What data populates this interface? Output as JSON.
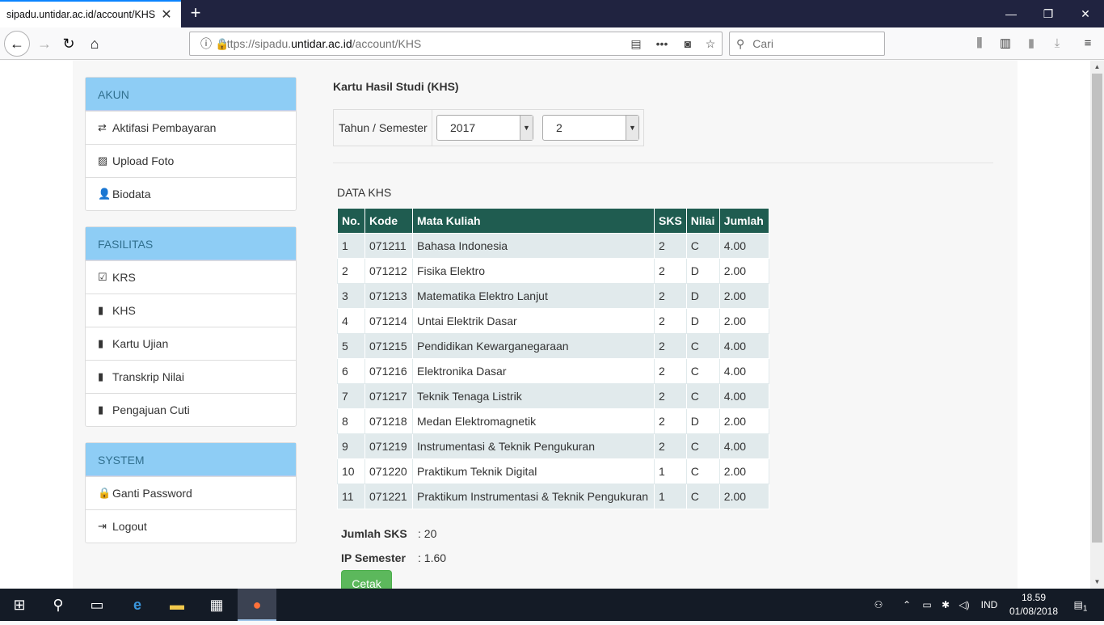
{
  "browser": {
    "tab_title": "sipadu.untidar.ac.id/account/KHS",
    "tab_close": "✕",
    "new_tab": "+",
    "url_prefix": "https://sipadu.",
    "url_domain": "untidar.ac.id",
    "url_path": "/account/KHS",
    "search_placeholder": "Cari",
    "window_controls": [
      "—",
      "❐",
      "✕"
    ]
  },
  "sidebar": {
    "akun": {
      "title": "AKUN",
      "items": [
        {
          "label": "Aktifasi Pembayaran",
          "icon": "transfer-icon"
        },
        {
          "label": "Upload Foto",
          "icon": "picture-icon"
        },
        {
          "label": "Biodata",
          "icon": "user-icon"
        }
      ]
    },
    "fasilitas": {
      "title": "FASILITAS",
      "items": [
        {
          "label": "KRS",
          "icon": "checkbox-icon"
        },
        {
          "label": "KHS",
          "icon": "file-icon"
        },
        {
          "label": "Kartu Ujian",
          "icon": "file-icon"
        },
        {
          "label": "Transkrip Nilai",
          "icon": "file-icon"
        },
        {
          "label": "Pengajuan Cuti",
          "icon": "file-icon"
        }
      ]
    },
    "system": {
      "title": "SYSTEM",
      "items": [
        {
          "label": "Ganti Password",
          "icon": "lock-icon"
        },
        {
          "label": "Logout",
          "icon": "logout-icon"
        }
      ]
    }
  },
  "main": {
    "title": "Kartu Hasil Studi (KHS)",
    "filter_label": "Tahun / Semester",
    "year_value": "2017",
    "semester_value": "2",
    "caption": "DATA KHS",
    "columns": [
      "No.",
      "Kode",
      "Mata Kuliah",
      "SKS",
      "Nilai",
      "Jumlah"
    ],
    "rows": [
      [
        "1",
        "071211",
        "Bahasa Indonesia",
        "2",
        "C",
        "4.00"
      ],
      [
        "2",
        "071212",
        "Fisika Elektro",
        "2",
        "D",
        "2.00"
      ],
      [
        "3",
        "071213",
        "Matematika Elektro Lanjut",
        "2",
        "D",
        "2.00"
      ],
      [
        "4",
        "071214",
        "Untai Elektrik Dasar",
        "2",
        "D",
        "2.00"
      ],
      [
        "5",
        "071215",
        "Pendidikan Kewarganegaraan",
        "2",
        "C",
        "4.00"
      ],
      [
        "6",
        "071216",
        "Elektronika Dasar",
        "2",
        "C",
        "4.00"
      ],
      [
        "7",
        "071217",
        "Teknik Tenaga Listrik",
        "2",
        "C",
        "4.00"
      ],
      [
        "8",
        "071218",
        "Medan Elektromagnetik",
        "2",
        "D",
        "2.00"
      ],
      [
        "9",
        "071219",
        "Instrumentasi & Teknik Pengukuran",
        "2",
        "C",
        "4.00"
      ],
      [
        "10",
        "071220",
        "Praktikum Teknik Digital",
        "1",
        "C",
        "2.00"
      ],
      [
        "11",
        "071221",
        "Praktikum Instrumentasi & Teknik Pengukuran",
        "1",
        "C",
        "2.00"
      ]
    ],
    "summary": {
      "sks_label": "Jumlah SKS",
      "sks_value": ": 20",
      "ip_label": "IP Semester",
      "ip_value": ": 1.60"
    },
    "print_label": "Cetak"
  },
  "taskbar": {
    "lang": "IND",
    "time": "18.59",
    "date": "01/08/2018",
    "notif_count": "1"
  }
}
